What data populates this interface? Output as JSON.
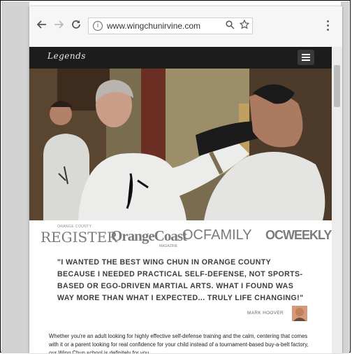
{
  "browser": {
    "back_icon": "arrow-left-icon",
    "forward_icon": "arrow-right-icon",
    "reload_icon": "reload-icon",
    "url": "www.wingchunirvine.com",
    "menu_icon": "kebab-menu-icon"
  },
  "site": {
    "logo_text": "Legends",
    "menu_icon": "hamburger-icon",
    "hero_shirt_text": "詠春",
    "press": [
      "REGISTER",
      "OrangeCoast",
      "OCFAMILY",
      "OCWEEKLY"
    ],
    "press_small": [
      "ORANGE COUNTY",
      "MAGAZINE"
    ],
    "quote": "\"I WANTED THE BEST WING CHUN IN ORANGE COUNTY BECAUSE I NEEDED PRACTICAL SELF-DEFENSE, NOT SPORTS-BASED OR EGO-DRIVEN MARTIAL ARTS. WHAT I FOUND WAS WAY MORE THAN WHAT I EXPECTED... TRULY LIFE CHANGING!\"",
    "author": "MARK HOOVER",
    "body": "Whether you're an adult looking for highly effective self-defense training and the calm, centering that comes with it or a parent looking for real confidence for your child instead of a tournament-based buy-a-belt factory, our Wing Chun school is definitely for you."
  }
}
